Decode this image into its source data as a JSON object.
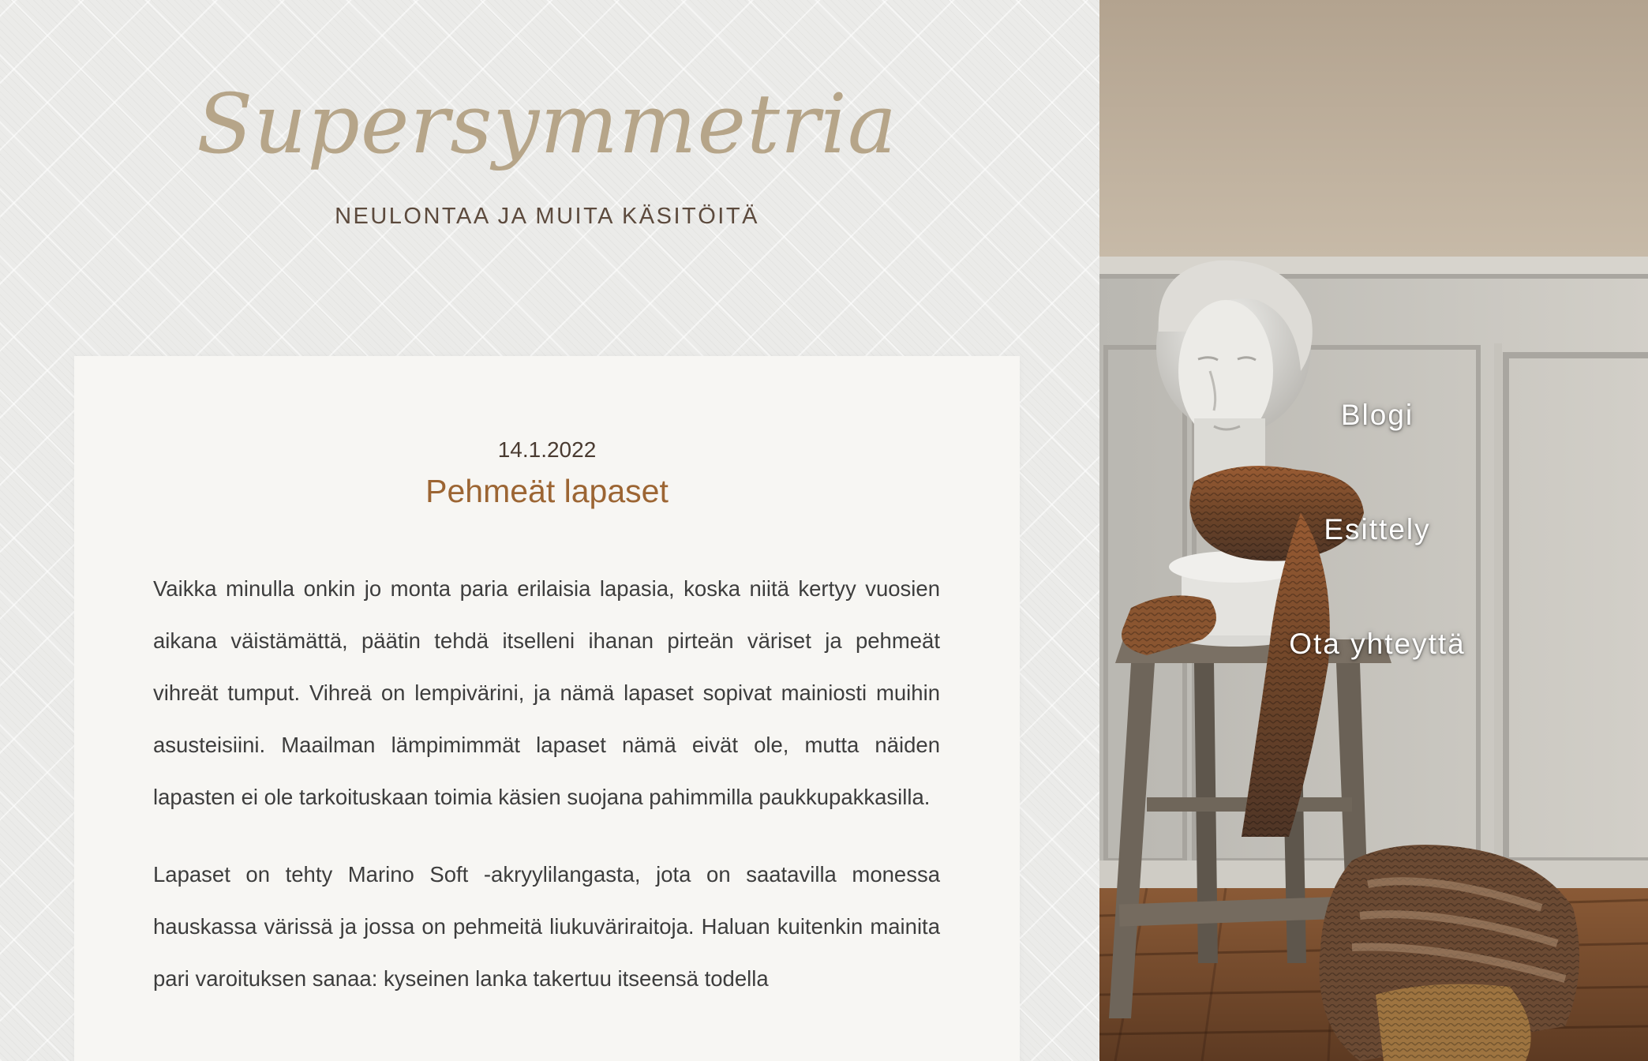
{
  "site": {
    "title": "Supersymmetria",
    "tagline": "NEULONTAA JA MUITA KÄSITÖITÄ"
  },
  "nav": {
    "items": [
      {
        "label": "Blogi"
      },
      {
        "label": "Esittely"
      },
      {
        "label": "Ota yhteyttä"
      }
    ]
  },
  "post": {
    "date": "14.1.2022",
    "title": "Pehmeät lapaset",
    "paragraphs": [
      "Vaikka minulla onkin jo monta paria erilaisia lapasia, koska niitä kertyy vuosien aikana väistämättä, päätin tehdä itselleni ihanan pirteän väriset ja pehmeät vihreät tumput. Vihreä on lempivärini, ja nämä lapaset sopivat mainiosti muihin asusteisiini. Maailman lämpimimmät lapaset nämä eivät ole, mutta näiden lapasten ei ole tarkoituskaan toimia käsien suojana pahimmilla paukkupakkasilla.",
      "Lapaset on tehty Marino Soft -akryylilangasta, jota on saatavilla monessa hauskassa värissä ja jossa on pehmeitä liukuväriraitoja. Haluan kuitenkin mainita pari varoituksen sanaa: kyseinen lanka takertuu itseensä todella"
    ]
  },
  "colors": {
    "title": "#b6a589",
    "tagline": "#5c4a3d",
    "post_title": "#9c6533",
    "body_text": "#3d3d3d",
    "card_bg": "#f7f6f3",
    "page_bg": "#ebebe9",
    "nav_text": "#ffffff"
  },
  "hero_image": {
    "subject": "plaster bust wearing a knitted scarf on a wooden stool"
  }
}
